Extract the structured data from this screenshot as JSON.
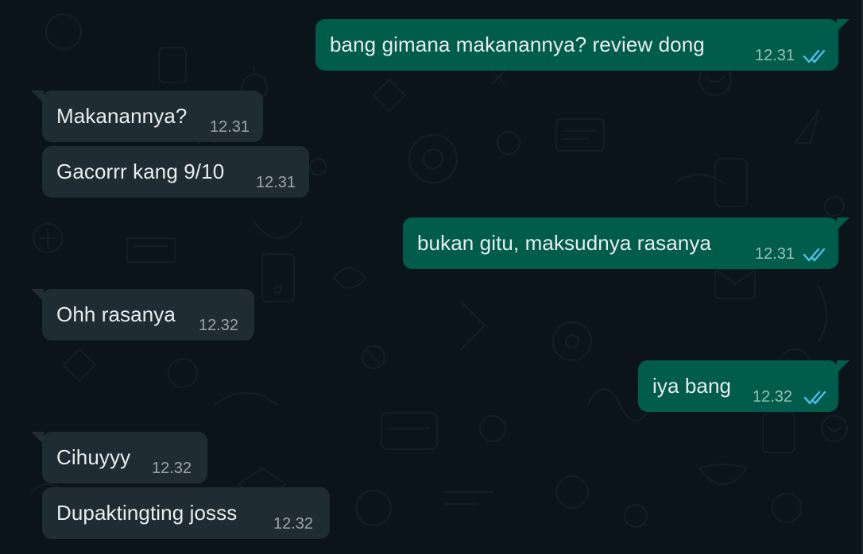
{
  "chat": {
    "messages": [
      {
        "direction": "out",
        "text": "bang gimana makanannya? review dong",
        "time": "12.31",
        "status": "read"
      },
      {
        "direction": "in",
        "text": "Makanannya?",
        "time": "12.31"
      },
      {
        "direction": "in",
        "text": "Gacorrr kang 9/10",
        "time": "12.31"
      },
      {
        "direction": "out",
        "text": "bukan gitu, maksudnya rasanya",
        "time": "12.31",
        "status": "read"
      },
      {
        "direction": "in",
        "text": "Ohh rasanya",
        "time": "12.32"
      },
      {
        "direction": "out",
        "text": "iya bang",
        "time": "12.32",
        "status": "read"
      },
      {
        "direction": "in",
        "text": "Cihuyyy",
        "time": "12.32"
      },
      {
        "direction": "in",
        "text": "Dupaktingting josss",
        "time": "12.32"
      }
    ]
  },
  "theme": {
    "background": "#0b141a",
    "incoming_bubble": "#202c33",
    "outgoing_bubble": "#005c4b",
    "read_tick_color": "#53bdeb"
  },
  "icons": {
    "read_receipt": "double-check-icon"
  }
}
